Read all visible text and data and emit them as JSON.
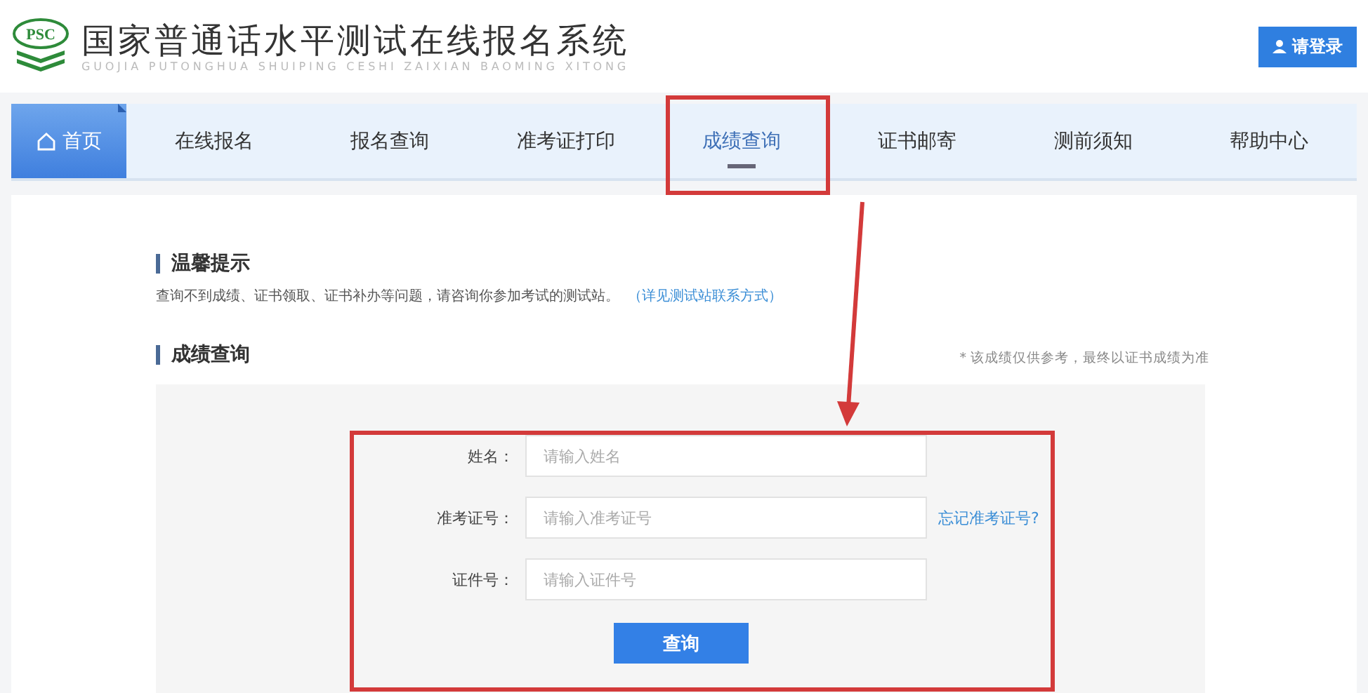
{
  "header": {
    "logo_text": "PSC",
    "title": "国家普通话水平测试在线报名系统",
    "subtitle": "GUOJIA PUTONGHUA SHUIPING CESHI ZAIXIAN BAOMING XITONG",
    "login_button": "请登录"
  },
  "nav": [
    {
      "label": "首页",
      "kind": "home",
      "selected": false
    },
    {
      "label": "在线报名",
      "kind": "link",
      "selected": false
    },
    {
      "label": "报名查询",
      "kind": "link",
      "selected": false
    },
    {
      "label": "准考证打印",
      "kind": "link",
      "selected": false
    },
    {
      "label": "成绩查询",
      "kind": "link",
      "selected": true
    },
    {
      "label": "证书邮寄",
      "kind": "link",
      "selected": false
    },
    {
      "label": "测前须知",
      "kind": "link",
      "selected": false
    },
    {
      "label": "帮助中心",
      "kind": "link",
      "selected": false
    }
  ],
  "notice": {
    "title": "温馨提示",
    "text": "查询不到成绩、证书领取、证书补办等问题，请咨询你参加考试的测试站。",
    "link": "（详见测试站联系方式）"
  },
  "query": {
    "title": "成绩查询",
    "note": "* 该成绩仅供参考，最终以证书成绩为准",
    "fields": [
      {
        "label": "姓名：",
        "placeholder": "请输入姓名"
      },
      {
        "label": "准考证号：",
        "placeholder": "请输入准考证号",
        "link": "忘记准考证号?"
      },
      {
        "label": "证件号：",
        "placeholder": "请输入证件号"
      }
    ],
    "submit": "查询"
  }
}
